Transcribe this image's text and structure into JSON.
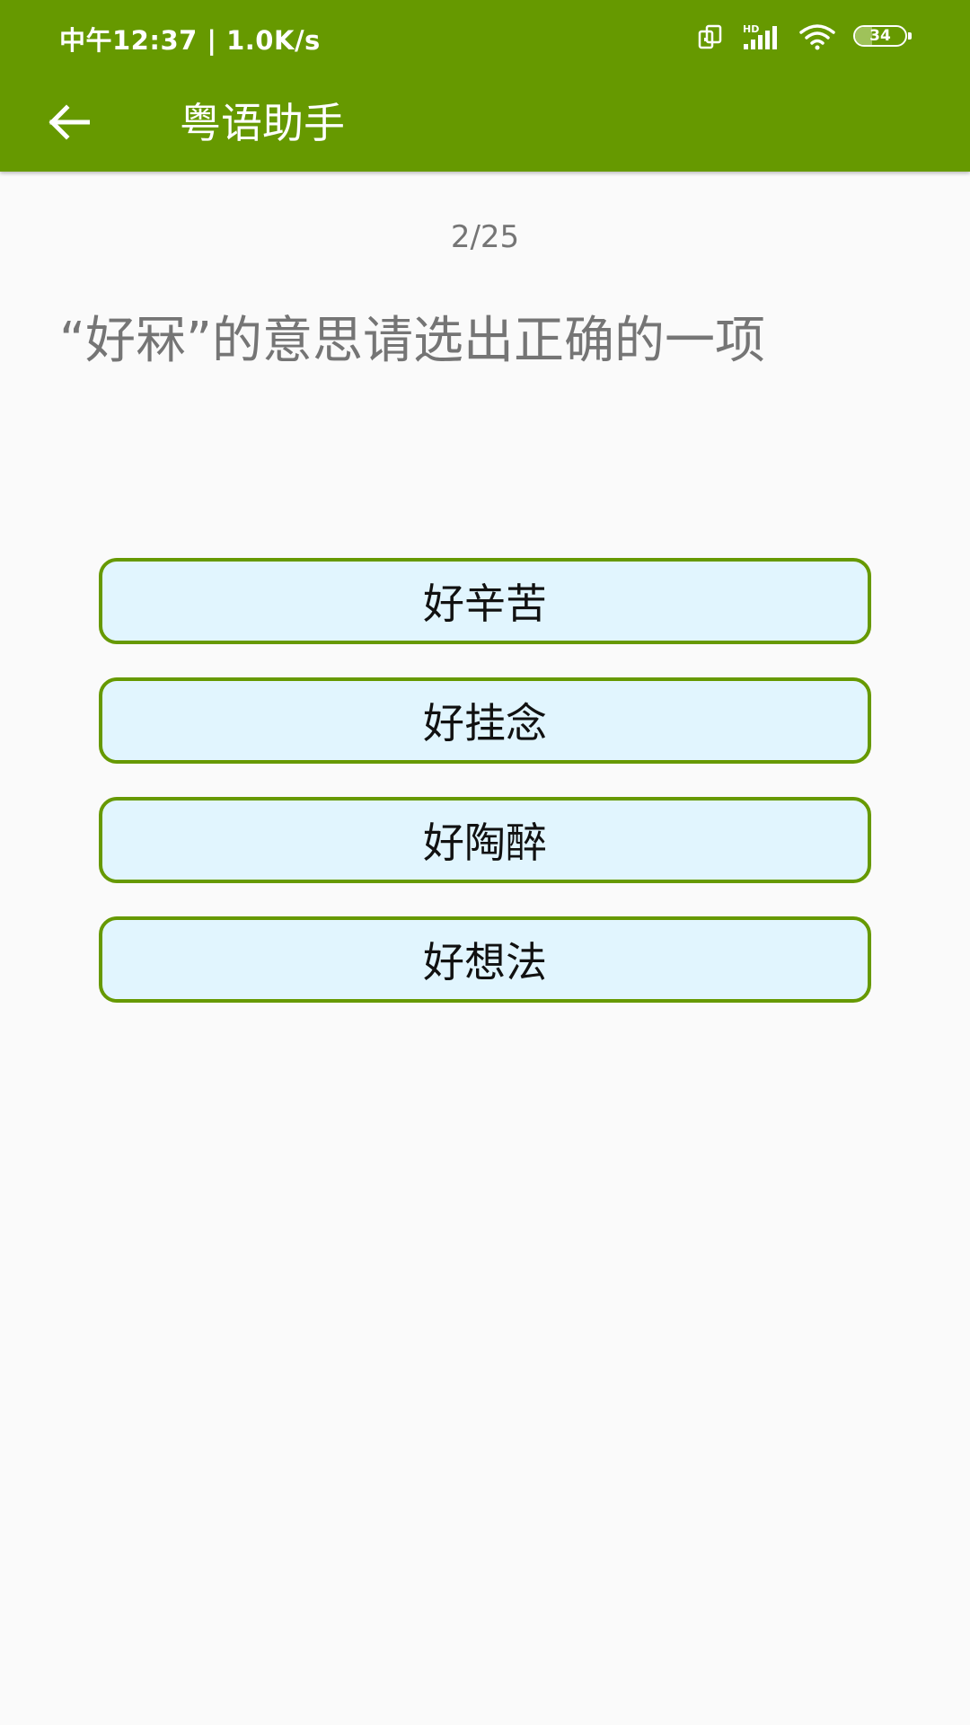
{
  "status_bar": {
    "time_speed": "中午12:37 | 1.0K/s",
    "hd_label": "HD",
    "battery_level": "34",
    "battery_fraction": 0.34
  },
  "app_bar": {
    "back_icon": "arrow-left-icon",
    "title": "粤语助手",
    "color": "#669900"
  },
  "quiz": {
    "progress": "2/25",
    "question": "“好冧”的意思请选出正确的一项",
    "options": [
      {
        "label": "好辛苦"
      },
      {
        "label": "好挂念"
      },
      {
        "label": "好陶醉"
      },
      {
        "label": "好想法"
      }
    ],
    "option_background": "#e1f5fe",
    "option_border": "#669900"
  }
}
